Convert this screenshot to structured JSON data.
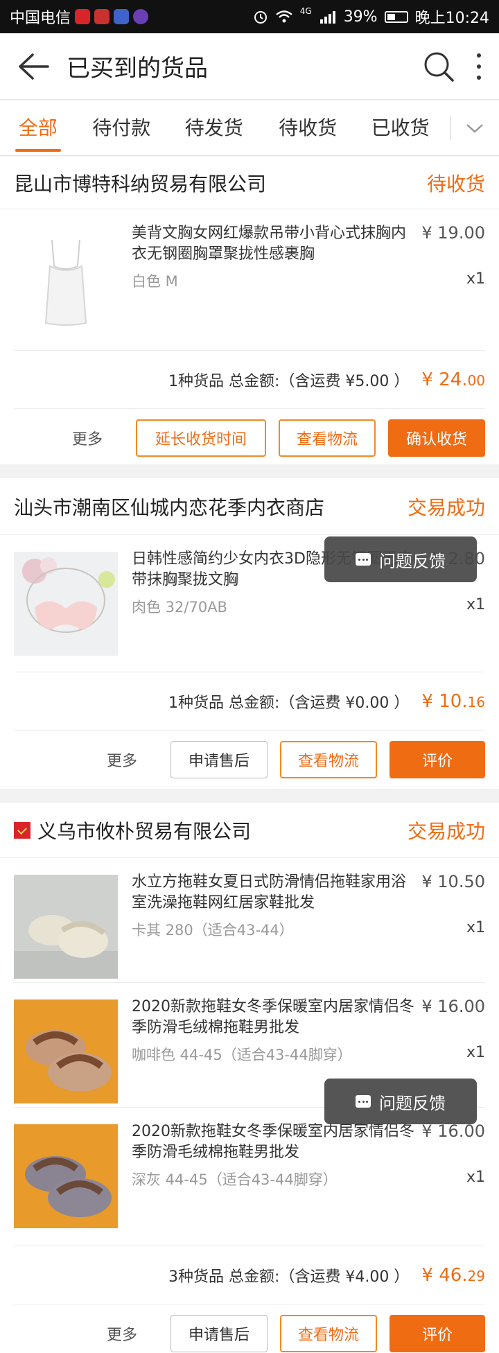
{
  "status_bar": {
    "carrier": "中国电信",
    "battery": "39%",
    "time": "晚上10:24",
    "net": "4G"
  },
  "header": {
    "title": "已买到的货品"
  },
  "tabs": [
    {
      "label": "全部",
      "active": true
    },
    {
      "label": "待付款"
    },
    {
      "label": "待发货"
    },
    {
      "label": "待收货"
    },
    {
      "label": "已收货"
    }
  ],
  "orders": [
    {
      "shop": "昆山市博特科纳贸易有限公司",
      "status": "待收货",
      "items": [
        {
          "name": "美背文胸女网红爆款吊带小背心式抹胸内衣无钢圈胸罩聚拢性感裹胸",
          "price": "¥ 19.00",
          "spec": "白色 M",
          "qty": "x1"
        }
      ],
      "summary": "1种货品 总金额:（含运费 ¥5.00 ）",
      "amount_int": "¥ 24.",
      "amount_dec": "00",
      "more": "更多",
      "buttons": [
        "延长收货时间",
        "查看物流",
        "确认收货"
      ]
    },
    {
      "shop": "汕头市潮南区仙城内恋花季内衣商店",
      "status": "交易成功",
      "items": [
        {
          "name": "日韩性感简约少女内衣3D隐形无钢圈无肩带抹胸聚拢文胸",
          "price": "¥ 2.80",
          "spec": "肉色 32/70AB",
          "qty": "x1"
        }
      ],
      "summary": "1种货品 总金额:（含运费 ¥0.00 ）",
      "amount_int": "¥ 10.",
      "amount_dec": "16",
      "more": "更多",
      "buttons": [
        "申请售后",
        "查看物流",
        "评价"
      ]
    },
    {
      "shop": "义乌市攸朴贸易有限公司",
      "status": "交易成功",
      "items": [
        {
          "name": "水立方拖鞋女夏日式防滑情侣拖鞋家用浴室洗澡拖鞋网红居家鞋批发",
          "price": "¥ 10.50",
          "spec": "卡其 280（适合43-44）",
          "qty": "x1"
        },
        {
          "name": "2020新款拖鞋女冬季保暖室内居家情侣冬季防滑毛绒棉拖鞋男批发",
          "price": "¥ 16.00",
          "spec": "咖啡色 44-45（适合43-44脚穿）",
          "qty": "x1"
        },
        {
          "name": "2020新款拖鞋女冬季保暖室内居家情侣冬季防滑毛绒棉拖鞋男批发",
          "price": "¥ 16.00",
          "spec": "深灰 44-45（适合43-44脚穿）",
          "qty": "x1"
        }
      ],
      "summary": "3种货品 总金额:（含运费 ¥4.00 ）",
      "amount_int": "¥ 46.",
      "amount_dec": "29",
      "more": "更多",
      "buttons": [
        "申请售后",
        "查看物流",
        "评价"
      ]
    }
  ],
  "feedback_label": "问题反馈",
  "colors": {
    "accent": "#ef6c13"
  }
}
